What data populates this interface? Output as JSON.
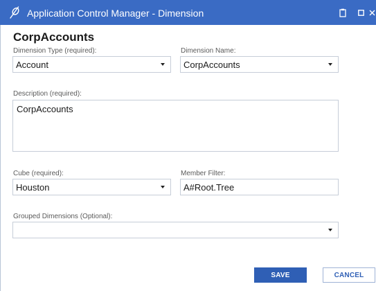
{
  "window": {
    "title": "Application Control Manager - Dimension",
    "logo_icon": "onestream-logo-icon",
    "controls": [
      "clipboard-icon",
      "restore-icon",
      "close-icon"
    ]
  },
  "page": {
    "title": "CorpAccounts"
  },
  "form": {
    "dimension_type": {
      "label": "Dimension Type (required):",
      "value": "Account"
    },
    "dimension_name": {
      "label": "Dimension Name:",
      "value": "CorpAccounts"
    },
    "description": {
      "label": "Description (required):",
      "value": "CorpAccounts"
    },
    "cube": {
      "label": "Cube (required):",
      "value": "Houston"
    },
    "member_filter": {
      "label": "Member Filter:",
      "value": "A#Root.Tree"
    },
    "grouped_dimensions": {
      "label": "Grouped Dimensions (Optional):",
      "value": ""
    }
  },
  "buttons": {
    "save": "SAVE",
    "cancel": "CANCEL"
  },
  "colors": {
    "titlebar": "#3a6bc4",
    "primary_button": "#2f5fb5",
    "field_border": "#c6cdd8"
  }
}
